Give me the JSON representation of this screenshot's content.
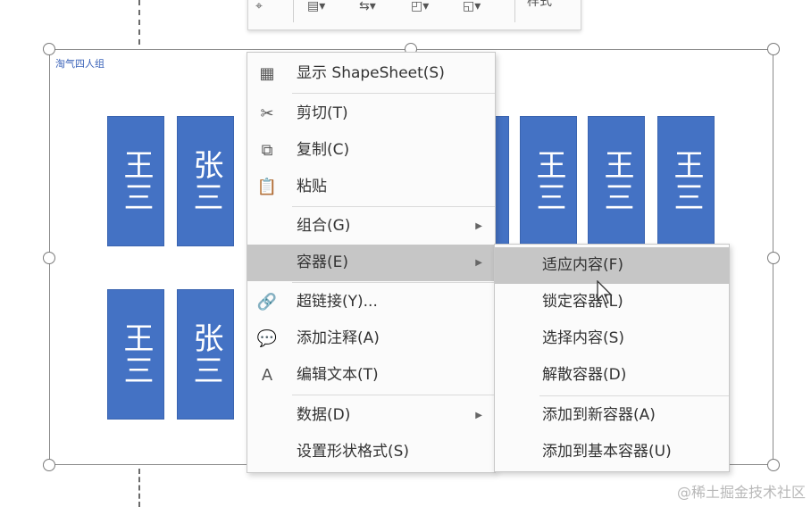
{
  "container": {
    "label": "淘气四人组"
  },
  "shapes": {
    "s1": "王三",
    "s2": "张三",
    "s3": "王三",
    "s4": "王三",
    "s5": "王三",
    "s6": "王三",
    "s7": "张三"
  },
  "context_menu": {
    "items": [
      {
        "label": "显示 ShapeSheet(S)",
        "icon": "shapesheet-icon"
      },
      {
        "label": "剪切(T)",
        "icon": "scissors-icon"
      },
      {
        "label": "复制(C)",
        "icon": "copy-icon"
      },
      {
        "label": "粘贴",
        "icon": "paste-icon"
      },
      {
        "label": "组合(G)",
        "submenu": true
      },
      {
        "label": "容器(E)",
        "submenu": true,
        "highlighted": true
      },
      {
        "label": "超链接(Y)...",
        "icon": "hyperlink-icon"
      },
      {
        "label": "添加注释(A)",
        "icon": "comment-icon"
      },
      {
        "label": "编辑文本(T)",
        "icon": "text-icon",
        "glyph": "A"
      },
      {
        "label": "数据(D)",
        "submenu": true
      },
      {
        "label": "设置形状格式(S)"
      }
    ]
  },
  "submenu": {
    "items": [
      {
        "label": "适应内容(F)",
        "highlighted": true
      },
      {
        "label": "锁定容器(L)"
      },
      {
        "label": "选择内容(S)"
      },
      {
        "label": "解散容器(D)"
      },
      {
        "label": "添加到新容器(A)"
      },
      {
        "label": "添加到基本容器(U)"
      }
    ]
  },
  "toolbar": {
    "style_label": "样式"
  },
  "watermark": "@稀土掘金技术社区",
  "colors": {
    "shape_fill": "#4472c4",
    "menu_highlight": "#c6c6c6"
  }
}
